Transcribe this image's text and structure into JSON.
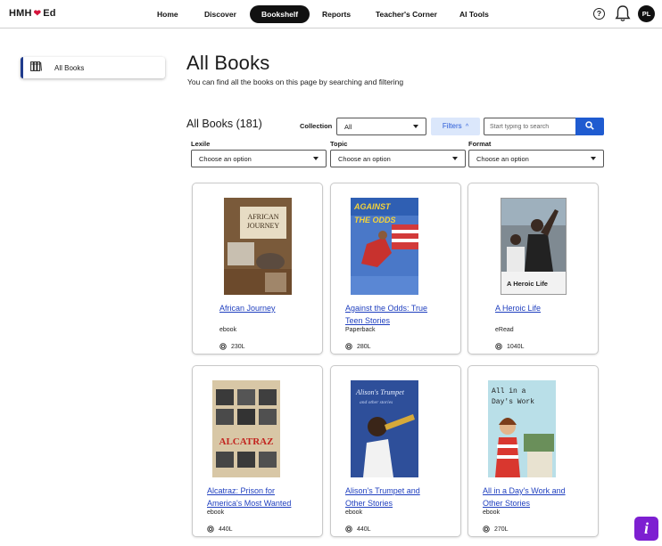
{
  "brand": {
    "name_left": "HMH",
    "name_right": "Ed"
  },
  "nav": {
    "home": "Home",
    "discover": "Discover",
    "bookshelf": "Bookshelf",
    "reports": "Reports",
    "teachers_corner": "Teacher's Corner",
    "ai_tools": "AI Tools"
  },
  "user": {
    "initials": "PL"
  },
  "help": {
    "glyph": "?"
  },
  "sidebar": {
    "all_books": "All Books"
  },
  "header": {
    "title": "All Books",
    "subtitle": "You can find all the books on this page by searching and filtering"
  },
  "toolbar": {
    "count_title": "All Books (181)",
    "collection_label": "Collection",
    "collection_value": "All",
    "filters_label": "Filters",
    "filters_chevron": "^",
    "search_placeholder": "Start typing to search"
  },
  "filters": {
    "lexile": {
      "label": "Lexile",
      "value": "Choose an option"
    },
    "topic": {
      "label": "Topic",
      "value": "Choose an option"
    },
    "format": {
      "label": "Format",
      "value": "Choose an option"
    }
  },
  "books": [
    {
      "title_l1": "African Journey",
      "title_l2": "",
      "format": "ebook",
      "lexile": "230L",
      "cover": {
        "text1": "AFRICAN",
        "text2": "JOURNEY",
        "bg": "#8a6a45"
      }
    },
    {
      "title_l1": "Against the Odds: True",
      "title_l2": "Teen Stories",
      "format": "Paperback",
      "lexile": "280L",
      "cover": {
        "text1": "AGAINST",
        "text2": "THE ODDS",
        "bg": "#4a78c8"
      }
    },
    {
      "title_l1": "A Heroic Life",
      "title_l2": "",
      "format": "eRead",
      "lexile": "1040L",
      "cover": {
        "text1": "A Heroic Life",
        "text2": "",
        "bg": "#e8e8e8"
      }
    },
    {
      "title_l1": "Alcatraz: Prison for",
      "title_l2": "America's Most Wanted",
      "format": "ebook",
      "lexile": "440L",
      "cover": {
        "text1": "ALCATRAZ",
        "text2": "",
        "bg": "#d8c7a6"
      }
    },
    {
      "title_l1": "Alison's Trumpet and",
      "title_l2": "Other Stories",
      "format": "ebook",
      "lexile": "440L",
      "cover": {
        "text1": "Alison's Trumpet",
        "text2": "and other stories",
        "bg": "#2e4f9a"
      }
    },
    {
      "title_l1": "All in a Day's Work and",
      "title_l2": "Other Stories",
      "format": "ebook",
      "lexile": "270L",
      "cover": {
        "text1": "All in a",
        "text2": "Day's Work",
        "bg": "#b9dfe8"
      }
    }
  ],
  "colors": {
    "accent": "#1f5bd0",
    "link": "#1f3fbf",
    "info": "#7d1fd1",
    "brand_heart": "#d4143b"
  },
  "icons": {
    "help": "help-circle-icon",
    "bell": "bell-icon",
    "books": "books-icon",
    "search": "search-icon",
    "lexile": "target-icon",
    "info": "info-icon"
  }
}
